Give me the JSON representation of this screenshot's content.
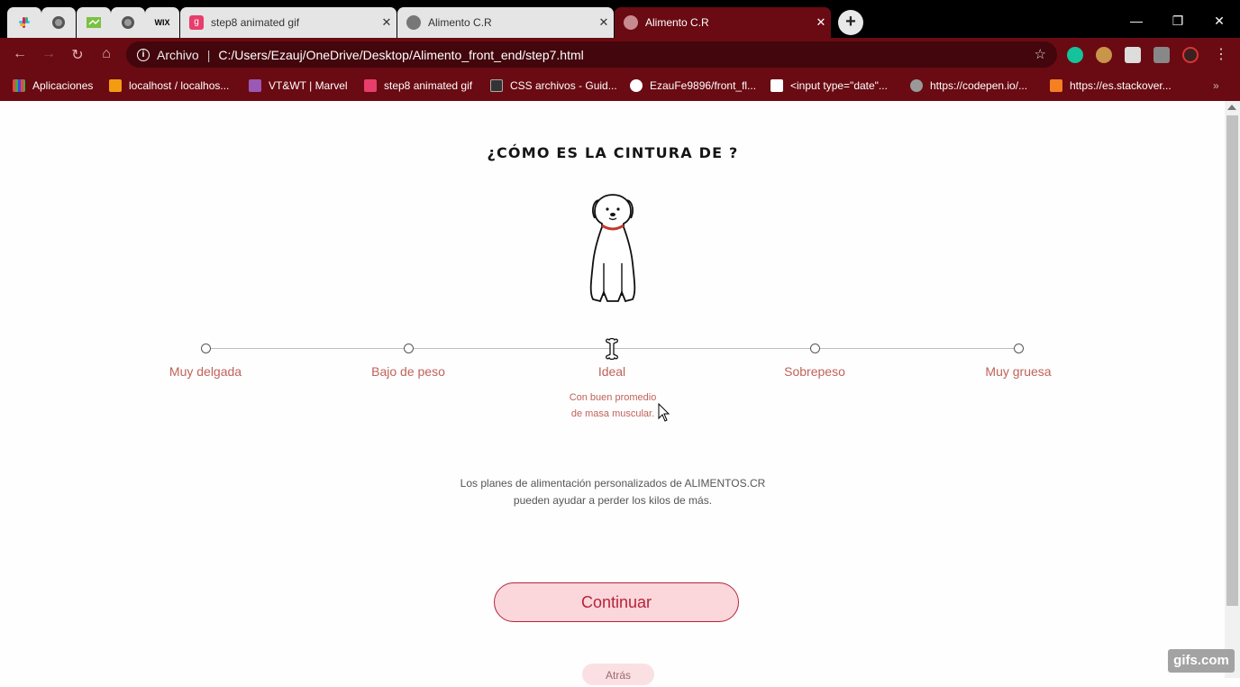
{
  "browser": {
    "tabs": [
      {
        "title": "step8 animated gif",
        "icon": "gif-icon"
      },
      {
        "title": "Alimento C.R",
        "icon": "globe-icon"
      },
      {
        "title": "Alimento C.R",
        "icon": "globe-icon",
        "active": true
      }
    ],
    "pinned_tabs": [
      "slack-icon",
      "globe-icon",
      "spreadsheet-icon",
      "globe-icon",
      "wix-icon"
    ],
    "address": {
      "security_label": "Archivo",
      "url": "C:/Users/Ezauj/OneDrive/Desktop/Alimento_front_end/step7.html"
    },
    "bookmarks": [
      "Aplicaciones",
      "localhost / localhos...",
      "VT&WT | Marvel",
      "step8 animated gif",
      "CSS archivos - Guid...",
      "EzauFe9896/front_fl...",
      "<input type=\"date\"...",
      "https://codepen.io/...",
      "https://es.stackover..."
    ],
    "accent": "#6a0a12"
  },
  "page": {
    "title": "¿CÓMO ES LA CINTURA DE ?",
    "slider": {
      "options": [
        "Muy delgada",
        "Bajo de peso",
        "Ideal",
        "Sobrepeso",
        "Muy gruesa"
      ],
      "selected_index": 2,
      "selected_description_line1": "Con buen promedio",
      "selected_description_line2": "de masa muscular."
    },
    "info_line1": "Los planes de alimentación personalizados de ALIMENTOS.CR",
    "info_line2": "pueden ayudar a perder los kilos de más.",
    "continue_label": "Continuar",
    "back_label": "Atrás",
    "accent_color": "#b5243a",
    "label_color": "#c0625a"
  },
  "watermark": "gifs.com"
}
